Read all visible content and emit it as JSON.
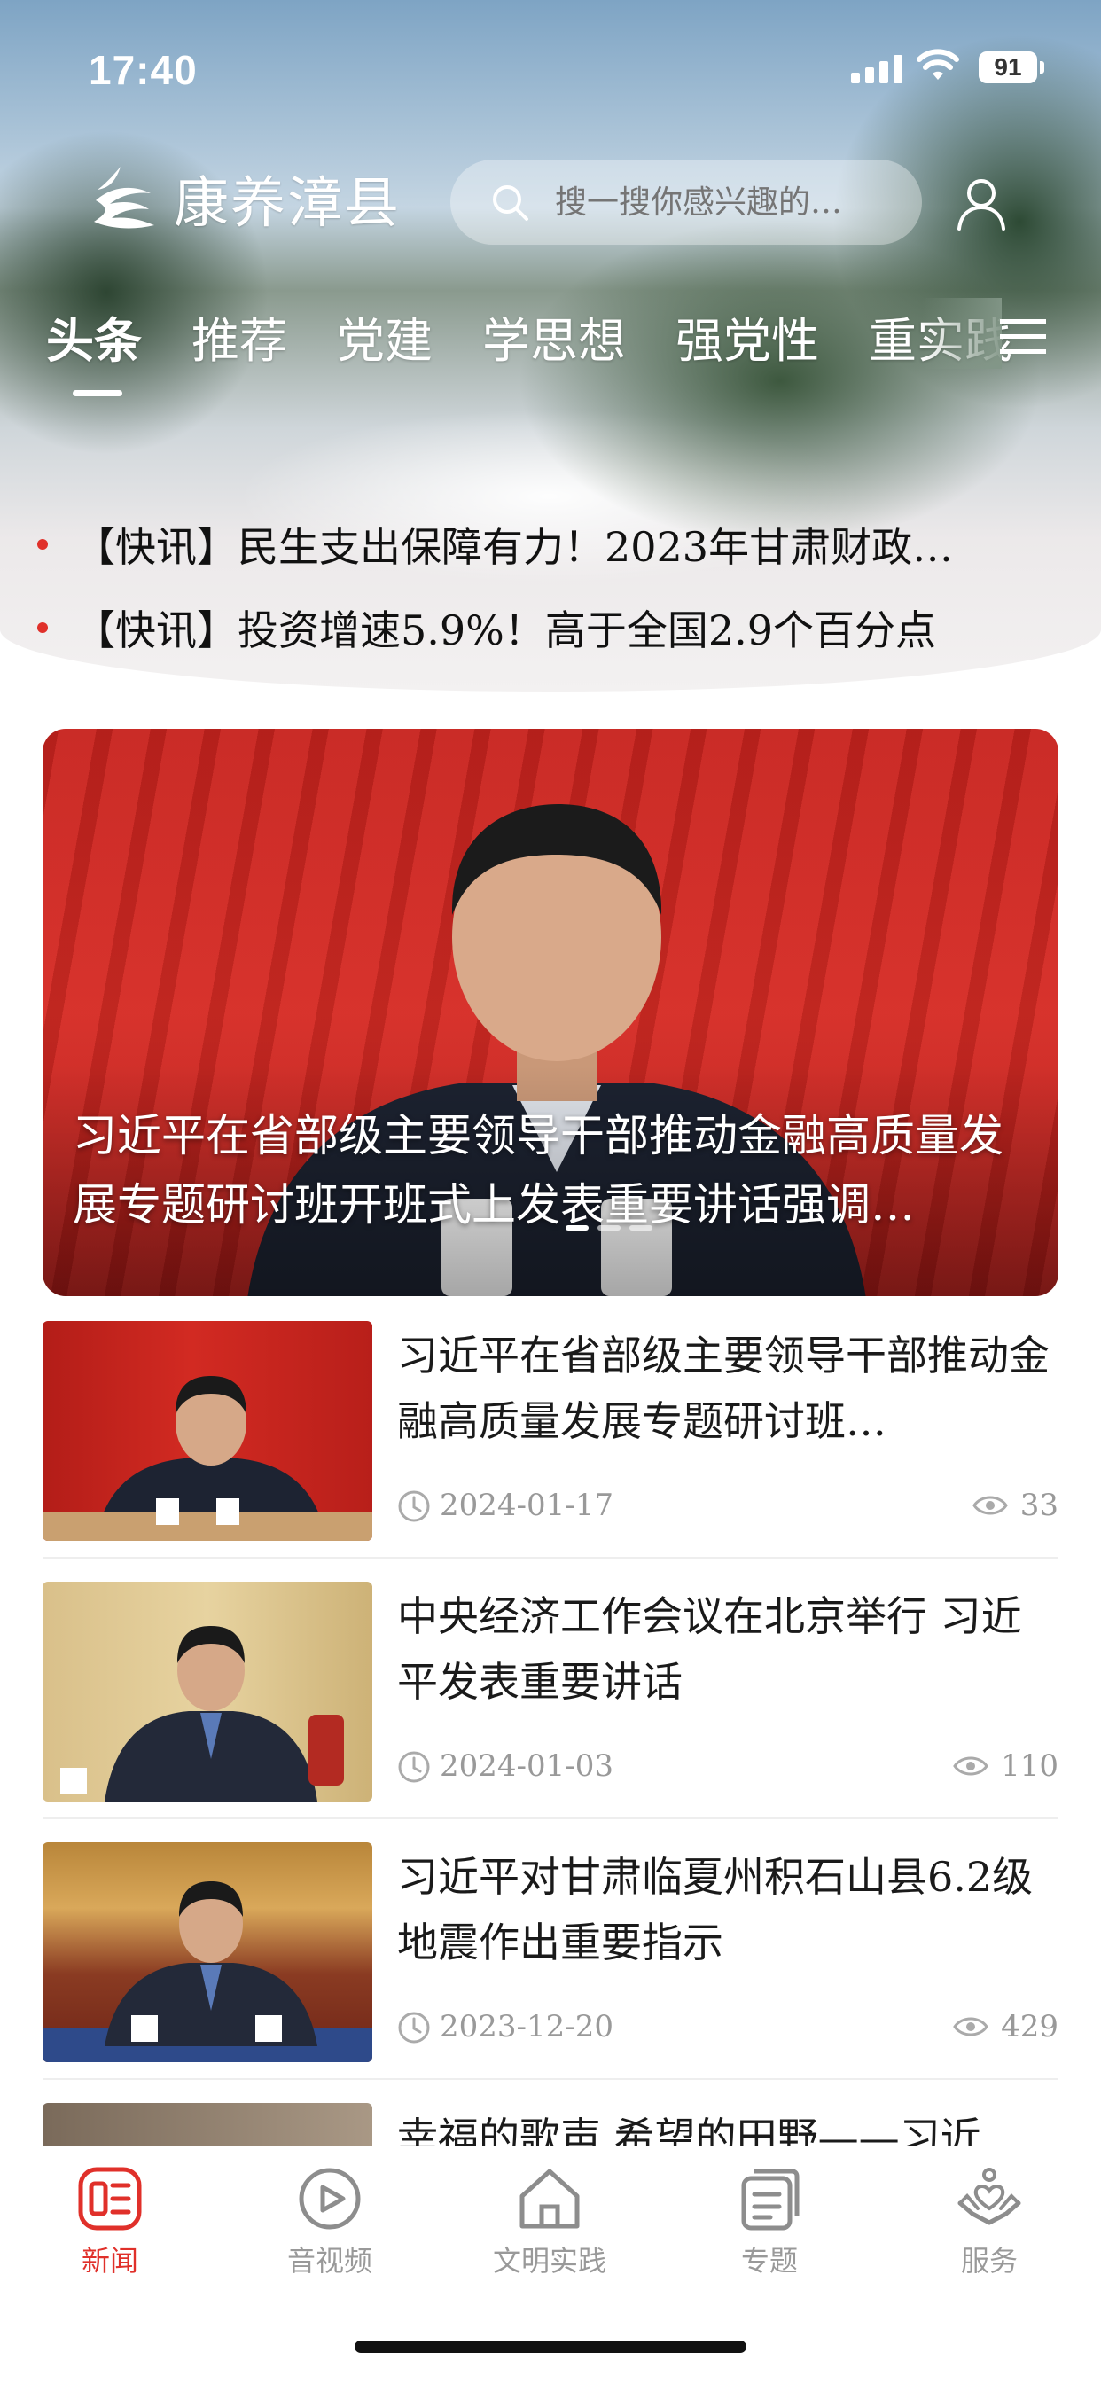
{
  "status_bar": {
    "time": "17:40",
    "battery": "91"
  },
  "header": {
    "app_name": "康养漳县",
    "search_placeholder": "搜一搜你感兴趣的…",
    "tabs": [
      "头条",
      "推荐",
      "党建",
      "学思想",
      "强党性",
      "重实践"
    ],
    "active_tab": "头条"
  },
  "flash_news": [
    {
      "text": "【快讯】民生支出保障有力！2023年甘肃财政…"
    },
    {
      "text": "【快讯】投资增速5.9%！高于全国2.9个百分点"
    }
  ],
  "banner": {
    "title": "习近平在省部级主要领导干部推动金融高质量发展专题研讨班开班式上发表重要讲话强调…"
  },
  "news": [
    {
      "title": "习近平在省部级主要领导干部推动金融高质量发展专题研讨班…",
      "date": "2024-01-17",
      "views": "33"
    },
    {
      "title": "中央经济工作会议在北京举行 习近平发表重要讲话",
      "date": "2024-01-03",
      "views": "110"
    },
    {
      "title": "习近平对甘肃临夏州积石山县6.2级地震作出重要指示",
      "date": "2023-12-20",
      "views": "429"
    },
    {
      "title": "幸福的歌声 希望的田野——习近"
    }
  ],
  "bottom_nav": [
    {
      "label": "新闻",
      "icon": "news-icon",
      "active": true
    },
    {
      "label": "音视频",
      "icon": "video-icon",
      "active": false
    },
    {
      "label": "文明实践",
      "icon": "home-icon",
      "active": false
    },
    {
      "label": "专题",
      "icon": "topic-icon",
      "active": false
    },
    {
      "label": "服务",
      "icon": "service-icon",
      "active": false
    }
  ],
  "colors": {
    "accent": "#e0302a",
    "muted": "#999999"
  }
}
